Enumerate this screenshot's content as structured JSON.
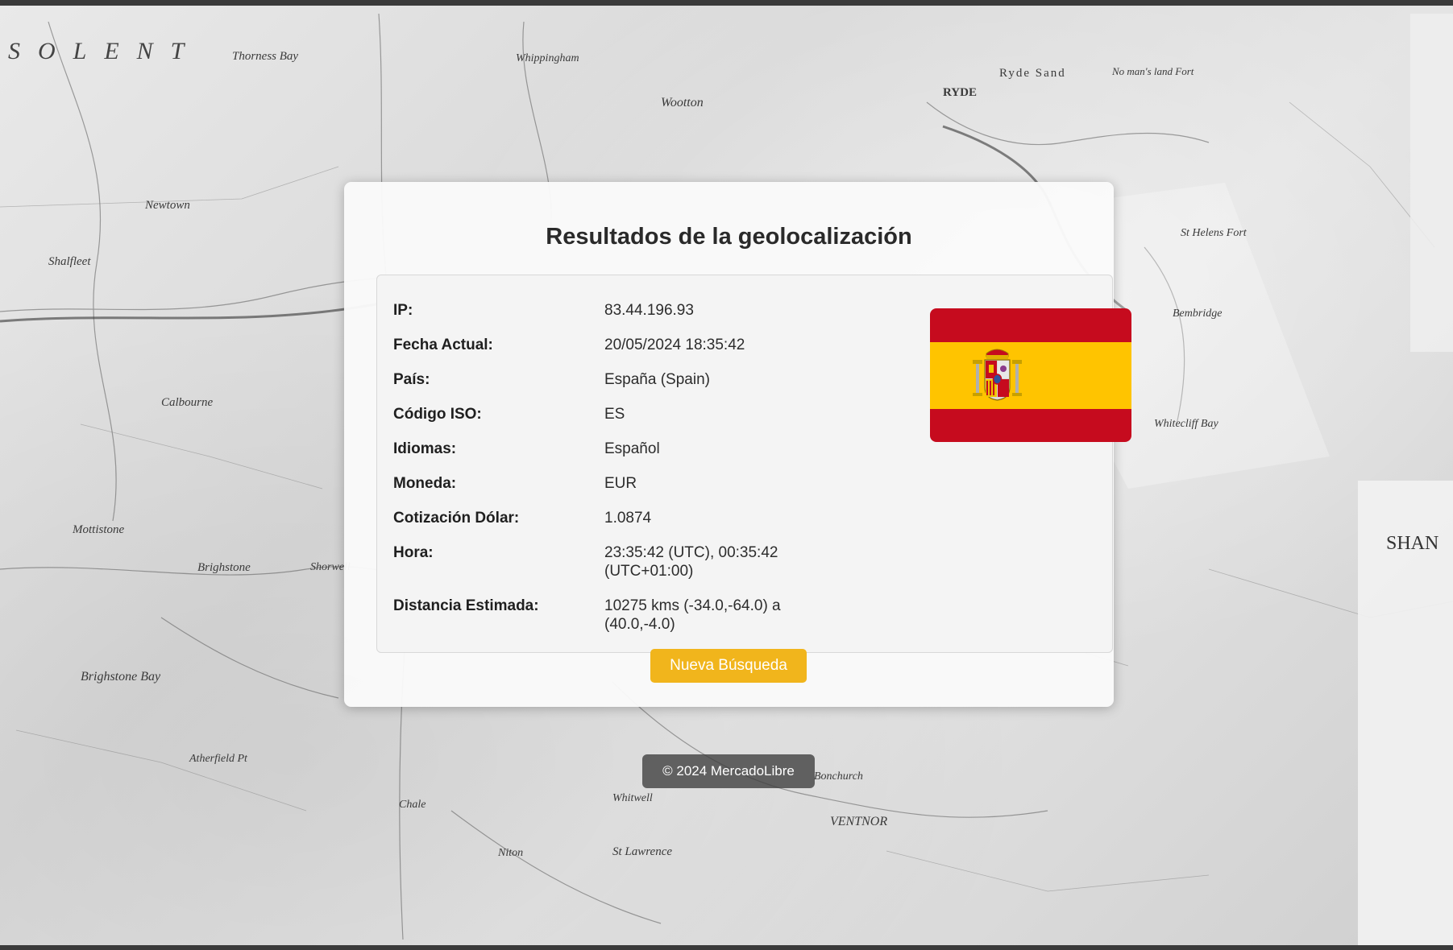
{
  "page": {
    "title": "Resultados de la geolocalización"
  },
  "results": {
    "rows": [
      {
        "label": "IP:",
        "value": "83.44.196.93"
      },
      {
        "label": "Fecha Actual:",
        "value": "20/05/2024 18:35:42"
      },
      {
        "label": "País:",
        "value": "España (Spain)"
      },
      {
        "label": "Código ISO:",
        "value": "ES"
      },
      {
        "label": "Idiomas:",
        "value": "Español"
      },
      {
        "label": "Moneda:",
        "value": "EUR"
      },
      {
        "label": "Cotización Dólar:",
        "value": "1.0874"
      },
      {
        "label": "Hora:",
        "value": "23:35:42 (UTC), 00:35:42 (UTC+01:00)"
      },
      {
        "label": "Distancia Estimada:",
        "value": "10275 kms (-34.0,-64.0) a (40.0,-4.0)"
      }
    ],
    "flag": {
      "country": "Spain",
      "icon": "spain-flag-icon",
      "colors": {
        "red": "#c60b1e",
        "yellow": "#ffc400"
      }
    }
  },
  "actions": {
    "new_search_label": "Nueva Búsqueda",
    "accent_color": "#f1b51c"
  },
  "footer": {
    "text": "© 2024 MercadoLibre"
  },
  "background": {
    "map_labels": [
      "SOLENT",
      "Thorness Bay",
      "Newtown",
      "Shalfleet",
      "Calbourne",
      "Brighstone",
      "Brighstone Bay",
      "Mottistone",
      "Shorwell",
      "Whippingham",
      "Wootton",
      "RYDE",
      "Ryde Sand",
      "No man's land Fort",
      "St Helens Fort",
      "Bembridge",
      "Whitecliff Bay",
      "VENTNOR",
      "Bonchurch",
      "Whitwell",
      "Niton",
      "Atherfield Pt",
      "Chale",
      "St Lawrence",
      "SHAN"
    ]
  }
}
